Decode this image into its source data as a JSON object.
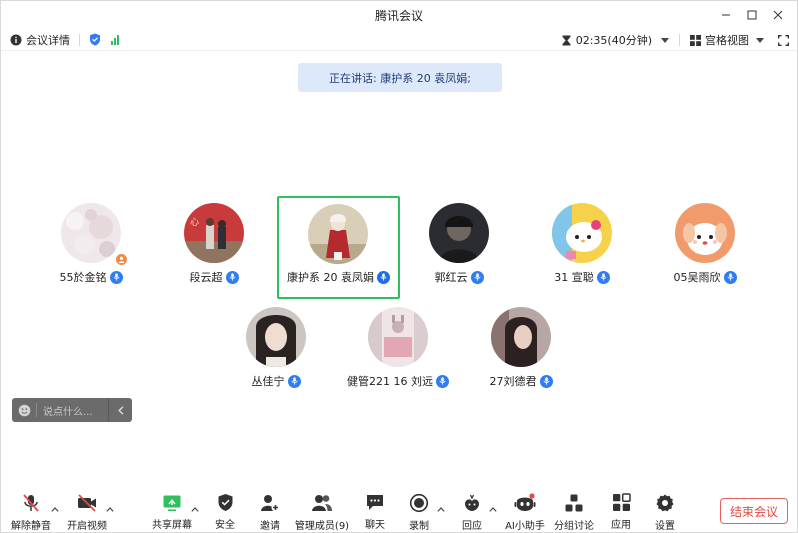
{
  "window": {
    "title": "腾讯会议"
  },
  "infobar": {
    "meeting_details": "会议详情",
    "timer": "02:35(40分钟)",
    "view_mode": "宫格视图"
  },
  "speaking": "正在讲话: 康护系 20 袁凤娟;",
  "participants": [
    {
      "name": "55於金铭",
      "host": true,
      "active": false
    },
    {
      "name": "段云超",
      "host": false,
      "active": false
    },
    {
      "name": "康护系 20 袁凤娟",
      "host": false,
      "active": true
    },
    {
      "name": "郭红云",
      "host": false,
      "active": false
    },
    {
      "name": "31 宣聪",
      "host": false,
      "active": false
    },
    {
      "name": "05吴雨欣",
      "host": false,
      "active": false
    },
    {
      "name": "丛佳宁",
      "host": false,
      "active": false
    },
    {
      "name": "健管221 16 刘远",
      "host": false,
      "active": false
    },
    {
      "name": "27刘德君",
      "host": false,
      "active": false
    }
  ],
  "chat": {
    "placeholder": "说点什么..."
  },
  "toolbar": {
    "unmute": "解除静音",
    "start_video": "开启视频",
    "share_screen": "共享屏幕",
    "security": "安全",
    "invite": "邀请",
    "manage_members": "管理成员(9)",
    "chat": "聊天",
    "record": "录制",
    "react": "回应",
    "ai_assistant": "AI小助手",
    "breakout": "分组讨论",
    "apps": "应用",
    "settings": "设置",
    "end_meeting": "结束会议"
  },
  "colors": {
    "accent": "#2f7cf6",
    "active_border": "#2fbf5f",
    "end_red": "#e04a43",
    "banner_bg": "#dde9fb"
  }
}
